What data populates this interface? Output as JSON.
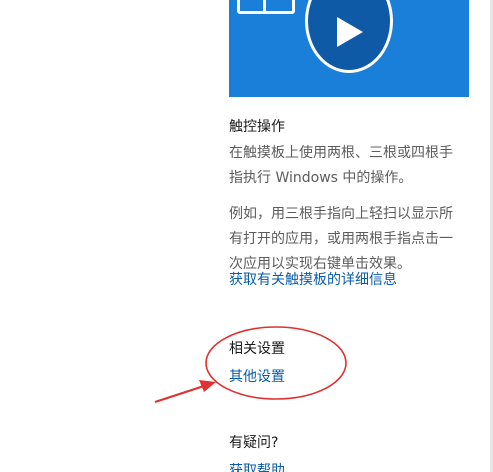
{
  "video": {
    "icon": "play-icon",
    "accent_color": "#1a7fd8"
  },
  "touch": {
    "heading": "触控操作",
    "line1": "在触摸板上使用两根、三根或四根手",
    "line2": "指执行 Windows 中的操作。",
    "line3": "例如，用三根手指向上轻扫以显示所",
    "line4": "有打开的应用，或用两根手指点击一",
    "line5": "次应用以实现右键单击效果。",
    "link": "获取有关触摸板的详细信息"
  },
  "related": {
    "heading": "相关设置",
    "link": "其他设置"
  },
  "question": {
    "heading": "有疑问?",
    "link": "获取帮助"
  },
  "colors": {
    "link": "#0a5ca8",
    "annotation": "#e03030"
  }
}
